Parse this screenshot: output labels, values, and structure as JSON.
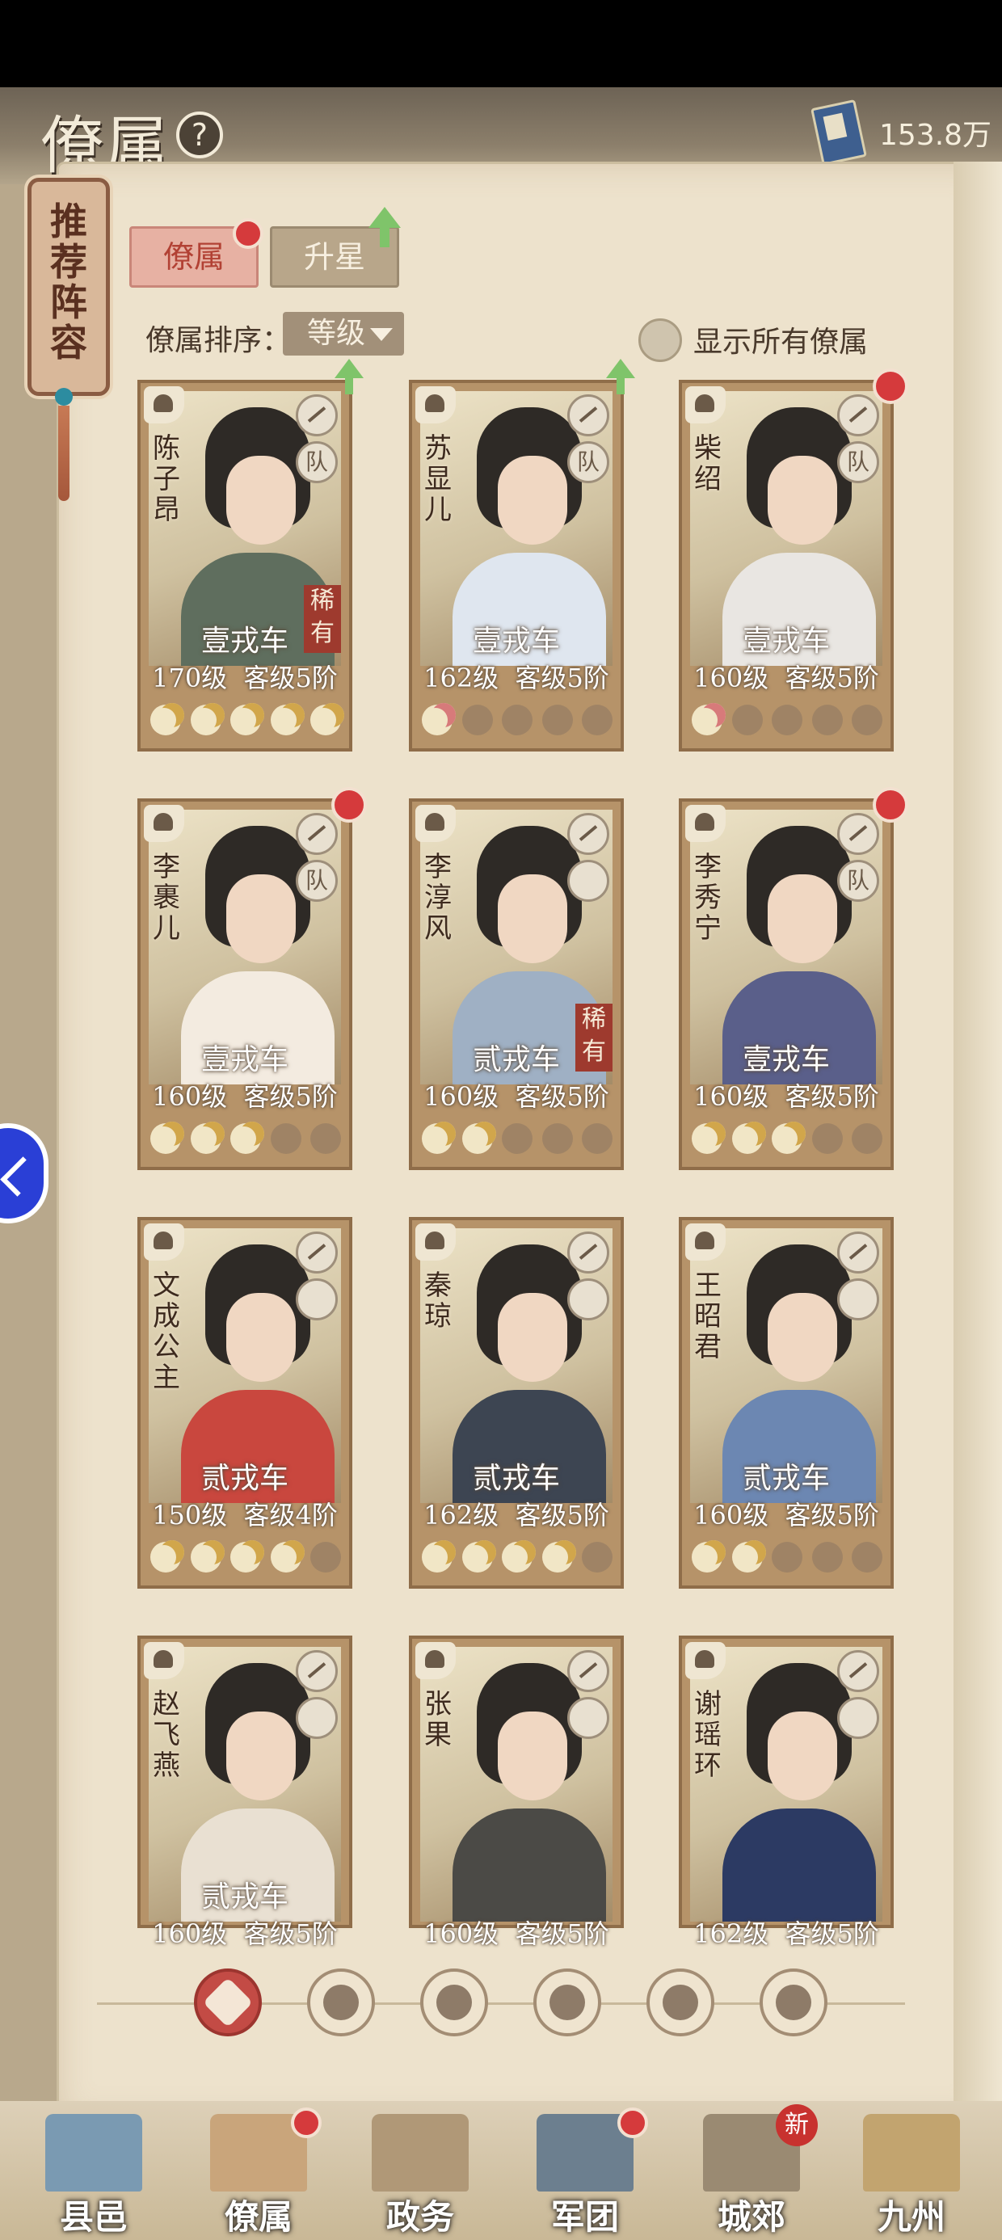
{
  "header": {
    "title": "僚属",
    "help_icon": "?",
    "currency_amount": "153.8万"
  },
  "side_tag": {
    "label": "推荐阵容"
  },
  "tabs": [
    {
      "label": "僚属",
      "active": true
    },
    {
      "label": "升星",
      "active": false
    }
  ],
  "sort": {
    "label": "僚属排序：",
    "selected": "等级"
  },
  "show_all": {
    "label": "显示所有僚属",
    "checked": false
  },
  "cards": [
    {
      "name": "陈子昂",
      "car": "壹戎车",
      "level": "170级",
      "rank": "客级5阶",
      "rare": "稀有",
      "skill2": "队",
      "moons": [
        1,
        1,
        1,
        1,
        1
      ],
      "badge": "up"
    },
    {
      "name": "苏显儿",
      "car": "壹戎车",
      "level": "162级",
      "rank": "客级5阶",
      "rare": "",
      "skill2": "队",
      "moons": [
        2,
        0,
        0,
        0,
        0
      ],
      "badge": "up"
    },
    {
      "name": "柴绍",
      "car": "壹戎车",
      "level": "160级",
      "rank": "客级5阶",
      "rare": "",
      "skill2": "队",
      "moons": [
        2,
        0,
        0,
        0,
        0
      ],
      "badge": "red"
    },
    {
      "name": "李裹儿",
      "car": "壹戎车",
      "level": "160级",
      "rank": "客级5阶",
      "rare": "",
      "skill2": "队",
      "moons": [
        1,
        1,
        1,
        0,
        0
      ],
      "badge": "red"
    },
    {
      "name": "李淳风",
      "car": "贰戎车",
      "level": "160级",
      "rank": "客级5阶",
      "rare": "稀有",
      "skill2": "",
      "moons": [
        1,
        1,
        0,
        0,
        0
      ],
      "badge": ""
    },
    {
      "name": "李秀宁",
      "car": "壹戎车",
      "level": "160级",
      "rank": "客级5阶",
      "rare": "",
      "skill2": "队",
      "moons": [
        1,
        1,
        1,
        0,
        0
      ],
      "badge": "red"
    },
    {
      "name": "文成公主",
      "car": "贰戎车",
      "level": "150级",
      "rank": "客级4阶",
      "rare": "",
      "skill2": "",
      "moons": [
        1,
        1,
        1,
        1,
        0
      ],
      "badge": ""
    },
    {
      "name": "秦琼",
      "car": "贰戎车",
      "level": "162级",
      "rank": "客级5阶",
      "rare": "",
      "skill2": "",
      "moons": [
        1,
        1,
        1,
        1,
        0
      ],
      "badge": ""
    },
    {
      "name": "王昭君",
      "car": "贰戎车",
      "level": "160级",
      "rank": "客级5阶",
      "rare": "",
      "skill2": "",
      "moons": [
        1,
        1,
        0,
        0,
        0
      ],
      "badge": ""
    },
    {
      "name": "赵飞燕",
      "car": "贰戎车",
      "level": "160级",
      "rank": "客级5阶",
      "rare": "",
      "skill2": "",
      "moons": [],
      "badge": ""
    },
    {
      "name": "张果",
      "car": "",
      "level": "160级",
      "rank": "客级5阶",
      "rare": "",
      "skill2": "",
      "moons": [],
      "badge": ""
    },
    {
      "name": "谢瑶环",
      "car": "",
      "level": "162级",
      "rank": "客级5阶",
      "rare": "",
      "skill2": "",
      "moons": [],
      "badge": ""
    }
  ],
  "bottom_nav": [
    {
      "label": "县邑",
      "dot": false,
      "new": ""
    },
    {
      "label": "僚属",
      "dot": true,
      "new": ""
    },
    {
      "label": "政务",
      "dot": false,
      "new": ""
    },
    {
      "label": "军团",
      "dot": true,
      "new": ""
    },
    {
      "label": "城郊",
      "dot": false,
      "new": "新"
    },
    {
      "label": "九州",
      "dot": false,
      "new": ""
    }
  ],
  "colors": {
    "accent_red": "#d53a3c",
    "parchment": "#ede2cc",
    "card_frame": "#b69369",
    "robe_colors": [
      "#5f6e5e",
      "#dfe6ef",
      "#e9e6e2",
      "#f3ebe0",
      "#9fb0c4",
      "#5a5f8a",
      "#c9473e",
      "#3d4552",
      "#6c87b2",
      "#e9e0d2",
      "#4b4a46",
      "#2c3a63"
    ]
  }
}
